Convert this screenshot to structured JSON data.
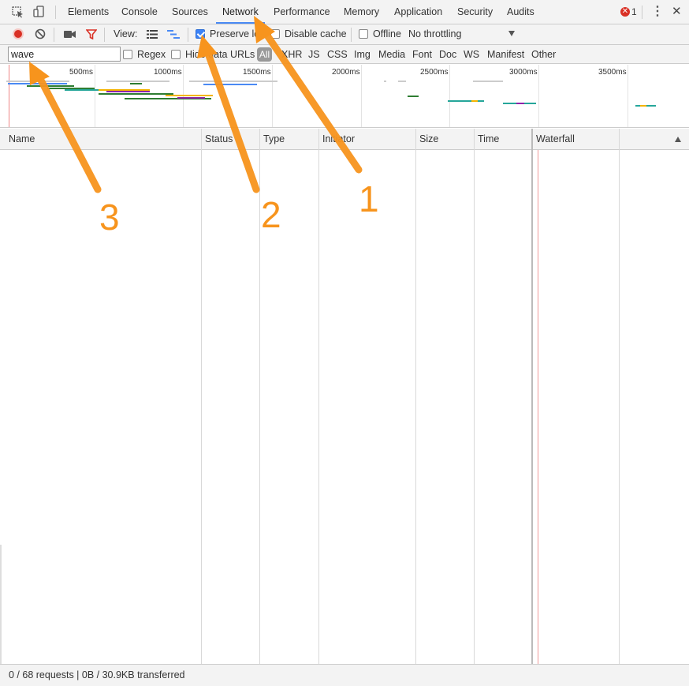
{
  "tabs": [
    "Elements",
    "Console",
    "Sources",
    "Network",
    "Performance",
    "Memory",
    "Application",
    "Security",
    "Audits"
  ],
  "active_tab": "Network",
  "error_count": "1",
  "toolbar": {
    "view_label": "View:",
    "preserve_log_label": "Preserve log",
    "preserve_log_checked": true,
    "disable_cache_label": "Disable cache",
    "offline_label": "Offline",
    "throttling_value": "No throttling"
  },
  "filter": {
    "value": "wave",
    "regex_label": "Regex",
    "hide_data_urls_label": "Hide data URLs",
    "types": [
      "All",
      "XHR",
      "JS",
      "CSS",
      "Img",
      "Media",
      "Font",
      "Doc",
      "WS",
      "Manifest",
      "Other"
    ]
  },
  "overview": {
    "ticks": [
      "500ms",
      "1000ms",
      "1500ms",
      "2000ms",
      "2500ms",
      "3000ms",
      "3500ms"
    ]
  },
  "columns": [
    "Name",
    "Status",
    "Type",
    "Initiator",
    "Size",
    "Time",
    "Waterfall"
  ],
  "status_text": "0 / 68 requests | 0B / 30.9KB transferred",
  "annotations": [
    "1",
    "2",
    "3"
  ],
  "colors": {
    "accent": "#4a8af4",
    "record": "#d93025",
    "filter_icon": "#d93025",
    "annotation": "#f7941d"
  }
}
